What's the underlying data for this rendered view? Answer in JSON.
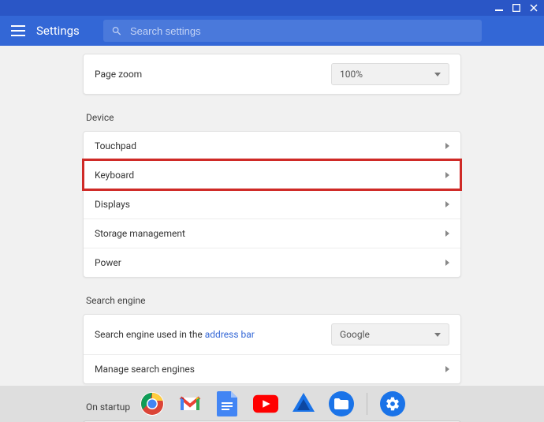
{
  "header": {
    "title": "Settings",
    "search_placeholder": "Search settings"
  },
  "page_zoom": {
    "label": "Page zoom",
    "value": "100%"
  },
  "device": {
    "section_title": "Device",
    "items": [
      {
        "label": "Touchpad"
      },
      {
        "label": "Keyboard",
        "highlighted": true
      },
      {
        "label": "Displays"
      },
      {
        "label": "Storage management"
      },
      {
        "label": "Power"
      }
    ]
  },
  "search_engine": {
    "section_title": "Search engine",
    "row_label_prefix": "Search engine used in the ",
    "row_link_text": "address bar",
    "selected": "Google",
    "manage_label": "Manage search engines"
  },
  "startup": {
    "section_title": "On startup"
  },
  "shelf_apps": [
    {
      "name": "chrome"
    },
    {
      "name": "gmail"
    },
    {
      "name": "docs"
    },
    {
      "name": "youtube"
    },
    {
      "name": "drive-sync"
    },
    {
      "name": "files"
    },
    {
      "name": "settings"
    }
  ]
}
